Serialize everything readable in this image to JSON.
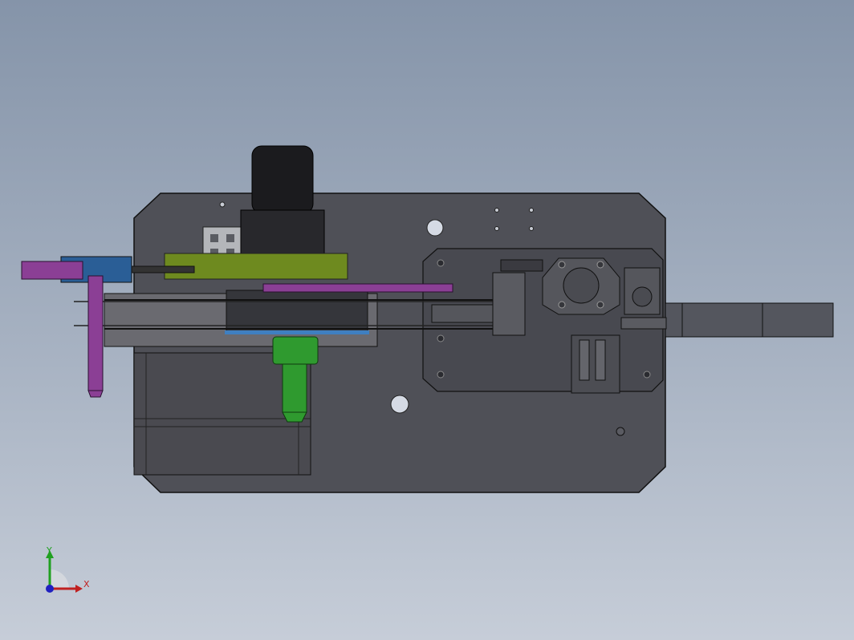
{
  "viewport": {
    "background_top": "#8594a9",
    "background_bottom": "#c6cdd8"
  },
  "model": {
    "base_plate_color": "#4f5057",
    "mount_plate_color": "#484950",
    "motor_color": "#1b1b1e",
    "frame_color": "#a8a9ab",
    "bracket_color": "#6e8a1f",
    "purple_part_color": "#8b3f95",
    "blue_block_color": "#2a5e96",
    "green_part_color": "#2f9a2f",
    "stepper_color": "#4a4a50"
  },
  "triad": {
    "x_label": "X",
    "y_label": "Y",
    "x_color": "#c02020",
    "y_color": "#20a020",
    "z_color": "#2020c0"
  }
}
